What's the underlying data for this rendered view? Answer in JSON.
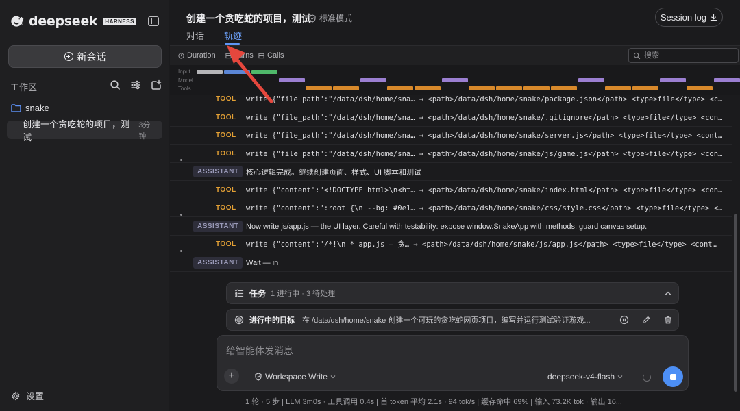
{
  "sidebar": {
    "brand": "deepseek",
    "badge": "HARNESS",
    "new_chat": "新会话",
    "workspace_label": "工作区",
    "folder": "snake",
    "session": {
      "dots": "..",
      "title": "创建一个贪吃蛇的项目，测试",
      "time": "3分钟"
    },
    "settings": "设置"
  },
  "header": {
    "title": "创建一个贪吃蛇的项目，测试",
    "mode": "标准模式",
    "session_log": "Session log",
    "tabs": [
      {
        "label": "对话"
      },
      {
        "label": "轨迹"
      }
    ],
    "active_tab": "轨迹"
  },
  "trace_toolbar": {
    "duration": "Duration",
    "turns": "Turns",
    "calls": "Calls",
    "search_placeholder": "搜索"
  },
  "timeline": {
    "labels": [
      "Input",
      "Model",
      "Tools"
    ],
    "colors": {
      "input": "#b5b5b8",
      "model": "#9b7fd1",
      "model_blue": "#5b86d6",
      "input_green": "#4fb86a",
      "tools": "#d8892b"
    }
  },
  "rows": [
    {
      "type": "TOOL",
      "text": "write {\"file_path\":\"/data/dsh/home/sna… → <path>/data/dsh/home/snake/package.json</path> <type>file</type> <c…",
      "mono": true
    },
    {
      "type": "TOOL",
      "text": "write {\"file_path\":\"/data/dsh/home/sna… → <path>/data/dsh/home/snake/.gitignore</path> <type>file</type> <con…",
      "mono": true
    },
    {
      "type": "TOOL",
      "text": "write {\"file_path\":\"/data/dsh/home/sna… → <path>/data/dsh/home/snake/server.js</path> <type>file</type> <cont…",
      "mono": true
    },
    {
      "type": "TOOL",
      "text": "write {\"file_path\":\"/data/dsh/home/sna… → <path>/data/dsh/home/snake/js/game.js</path> <type>file</type> <con…",
      "mono": true
    },
    {
      "type": "ASSISTANT",
      "text": "核心逻辑完成。继续创建页面、样式、UI 脚本和测试",
      "mono": false
    },
    {
      "type": "TOOL",
      "text": "write {\"content\":\"<!DOCTYPE html>\\n<ht… → <path>/data/dsh/home/snake/index.html</path> <type>file</type> <con…",
      "mono": true
    },
    {
      "type": "TOOL",
      "text": "write {\"content\":\":root {\\n  --bg: #0e1… → <path>/data/dsh/home/snake/css/style.css</path> <type>file</type> <…",
      "mono": true
    },
    {
      "type": "ASSISTANT",
      "text": "Now write js/app.js — the UI layer. Careful with testability: expose window.SnakeApp with methods; guard canvas setup.",
      "mono": false
    },
    {
      "type": "TOOL",
      "text": "write {\"content\":\"/*!\\n * app.js — 贪… → <path>/data/dsh/home/snake/js/app.js</path> <type>file</type> <cont…",
      "mono": true
    },
    {
      "type": "ASSISTANT",
      "text": "Wait — in",
      "mono": false
    }
  ],
  "tasks": {
    "title": "任务",
    "meta": "1 进行中 · 3 待处理",
    "goal_label": "进行中的目标",
    "goal_text": "在 /data/dsh/home/snake 创建一个可玩的贪吃蛇网页项目，编写并运行测试验证游戏..."
  },
  "composer": {
    "placeholder": "给智能体发消息",
    "mode": "Workspace Write",
    "model": "deepseek-v4-flash"
  },
  "stats": "1 轮 · 5 步   |   LLM 3m0s · 工具调用 0.4s   |   首 token 平均 2.1s · 94 tok/s   |   缓存命中 69%   |   输入 73.2K tok · 输出 16...",
  "colors": {
    "accent": "#5e95f5",
    "tool": "#e3a035",
    "assistant_badge": "#2e2e3a",
    "arrow": "#e5473d"
  }
}
